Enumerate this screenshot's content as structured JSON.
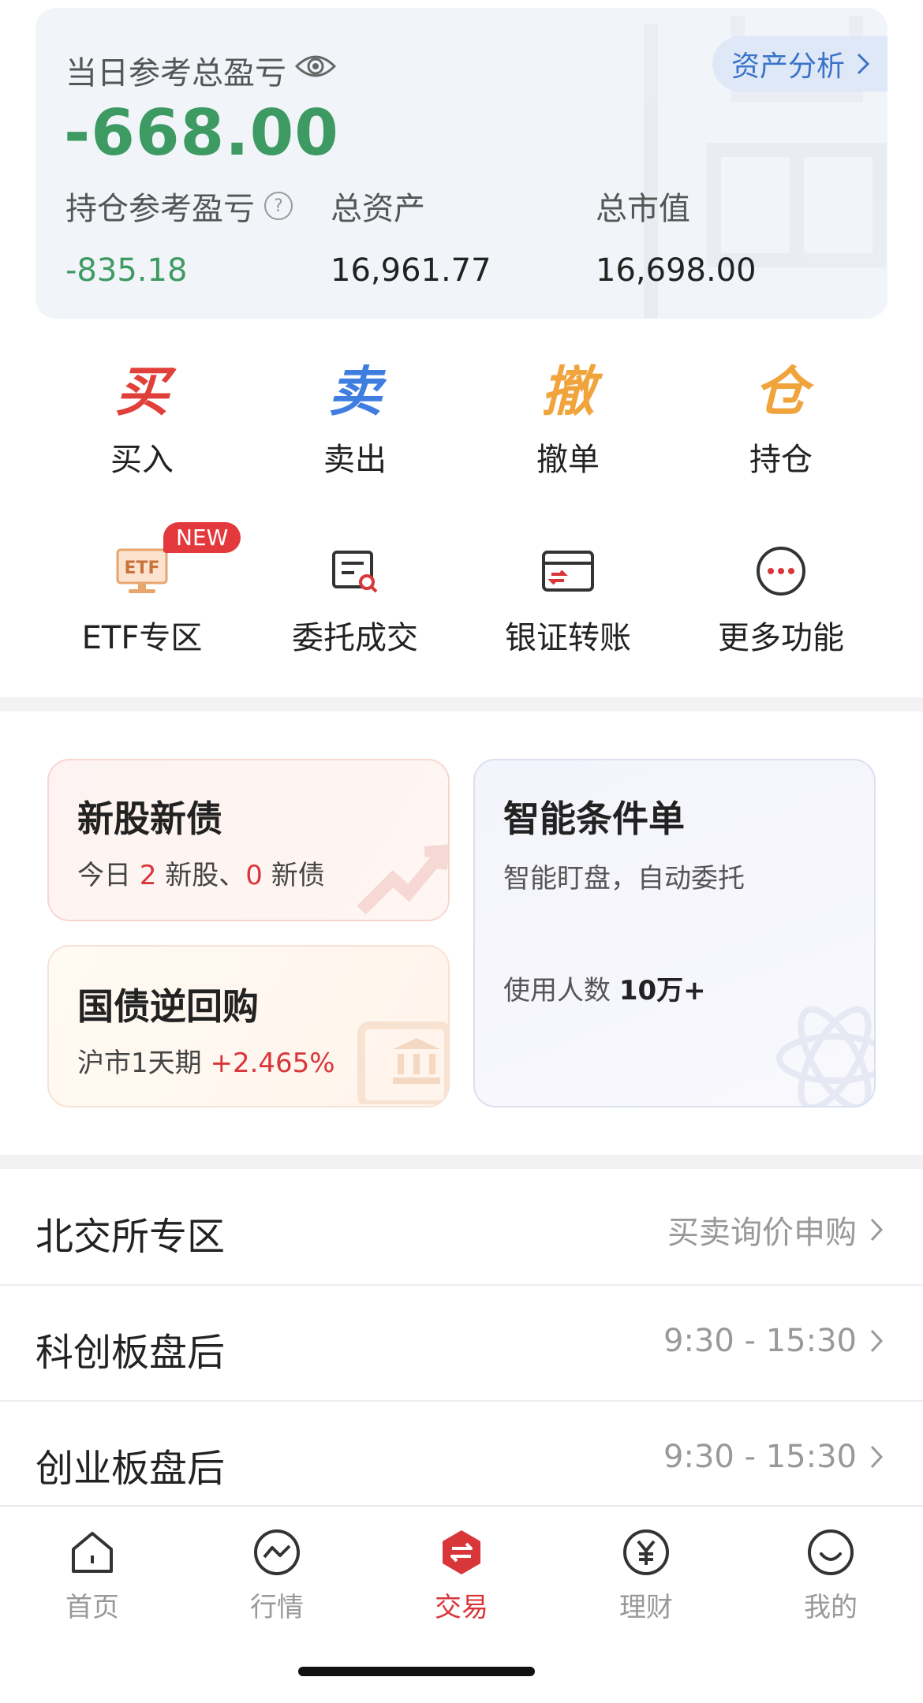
{
  "summary": {
    "daily_label": "当日参考总盈亏",
    "daily_value": "-668.00",
    "analysis_label": "资产分析",
    "holding_label": "持仓参考盈亏",
    "holding_value": "-835.18",
    "total_assets_label": "总资产",
    "total_assets_value": "16,961.77",
    "market_value_label": "总市值",
    "market_value_value": "16,698.00"
  },
  "actions_row1": [
    {
      "glyph": "买",
      "label": "买入",
      "color": "#e1403a"
    },
    {
      "glyph": "卖",
      "label": "卖出",
      "color": "#3f7ee0"
    },
    {
      "glyph": "撤",
      "label": "撤单",
      "color": "#f0a43b"
    },
    {
      "glyph": "仓",
      "label": "持仓",
      "color": "#f0a43b"
    }
  ],
  "actions_row2": [
    {
      "label": "ETF专区",
      "icon": "etf-icon",
      "badge": "NEW"
    },
    {
      "label": "委托成交",
      "icon": "order-search-icon"
    },
    {
      "label": "银证转账",
      "icon": "transfer-card-icon"
    },
    {
      "label": "更多功能",
      "icon": "more-icon"
    }
  ],
  "cards": {
    "ipo": {
      "title": "新股新债",
      "sub_prefix": "今日 ",
      "stock_count": "2",
      "mid": " 新股、",
      "bond_count": "0",
      "suffix": " 新债"
    },
    "repo": {
      "title": "国债逆回购",
      "sub_prefix": "沪市1天期 ",
      "rate": "+2.465%"
    },
    "smart": {
      "title": "智能条件单",
      "sub": "智能盯盘，自动委托",
      "users_prefix": "使用人数 ",
      "users_value": "10万+"
    }
  },
  "list": [
    {
      "label": "北交所专区",
      "right": "买卖询价申购"
    },
    {
      "label": "科创板盘后",
      "right": "9:30 - 15:30"
    },
    {
      "label": "创业板盘后",
      "right": "9:30 - 15:30"
    }
  ],
  "tabs": [
    {
      "label": "首页",
      "icon": "home-icon"
    },
    {
      "label": "行情",
      "icon": "market-icon"
    },
    {
      "label": "交易",
      "icon": "trade-icon",
      "active": true
    },
    {
      "label": "理财",
      "icon": "wealth-icon"
    },
    {
      "label": "我的",
      "icon": "profile-icon"
    }
  ],
  "colors": {
    "accent_red": "#d9363a",
    "profit_green": "#3d9a62",
    "link_blue": "#3a73c9"
  }
}
